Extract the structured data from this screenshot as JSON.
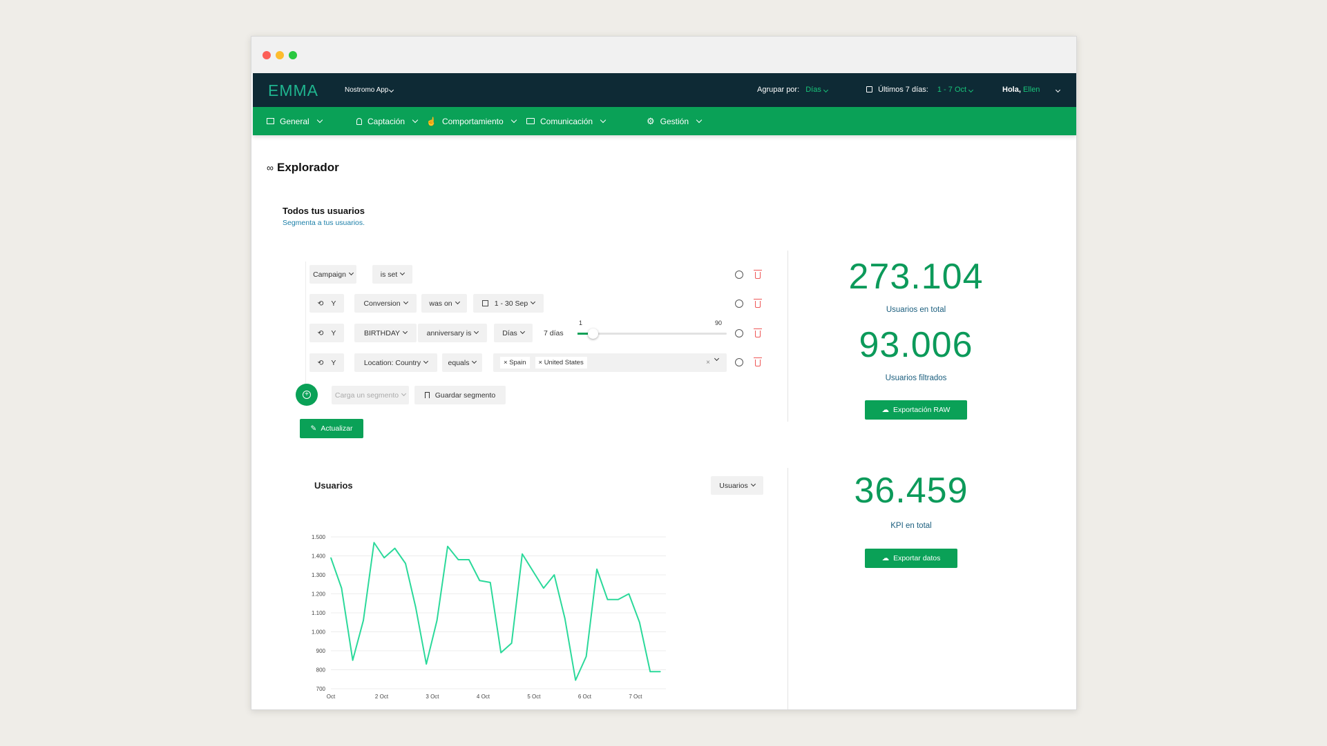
{
  "topbar": {
    "logo": "EMMA",
    "app": "Nostromo App",
    "group_label": "Agrupar por:",
    "group_value": "Días",
    "range_label": "Últimos 7 días:",
    "range_value": "1 - 7 Oct",
    "greeting": "Hola,",
    "user": "Ellen"
  },
  "nav": [
    {
      "label": "General",
      "icon": "dashboard-icon"
    },
    {
      "label": "Captación",
      "icon": "user-icon"
    },
    {
      "label": "Comportamiento",
      "icon": "hand-pointer-icon"
    },
    {
      "label": "Comunicación",
      "icon": "chat-icon"
    },
    {
      "label": "Gestión",
      "icon": "gear-icon"
    }
  ],
  "page": {
    "title": "Explorador",
    "section_title": "Todos tus usuarios",
    "section_subtitle": "Segmenta a tus usuarios."
  },
  "filters": {
    "row1": {
      "field": "Campaign",
      "op": "is set"
    },
    "row2": {
      "join": "Y",
      "field": "Conversion",
      "op": "was on",
      "value": "1 - 30 Sep"
    },
    "row3": {
      "join": "Y",
      "field": "BIRTHDAY",
      "op": "anniversary is",
      "unit": "Días",
      "days": "7 días",
      "slider_min": "1",
      "slider_max": "90",
      "slider_value": 7
    },
    "row4": {
      "join": "Y",
      "field": "Location: Country",
      "op": "equals",
      "tags": [
        "Spain",
        "United States"
      ]
    },
    "load_placeholder": "Carga un segmento",
    "save_label": "Guardar segmento",
    "update_label": "Actualizar"
  },
  "stats": {
    "total_value": "273.104",
    "total_label": "Usuarios en total",
    "filtered_value": "93.006",
    "filtered_label": "Usuarios filtrados",
    "export_raw": "Exportación RAW",
    "kpi_value": "36.459",
    "kpi_label": "KPI en total",
    "export_data": "Exportar datos"
  },
  "chart_panel": {
    "title": "Usuarios",
    "select": "Usuarios"
  },
  "chart_data": {
    "type": "line",
    "title": "Usuarios",
    "xlabel": "",
    "ylabel": "",
    "ylim": [
      700,
      1500
    ],
    "yticks": [
      "1.500",
      "1.400",
      "1.300",
      "1.200",
      "1.100",
      "1.000",
      "900",
      "800",
      "700"
    ],
    "xticks": [
      {
        "label": "Oct",
        "x": 0
      },
      {
        "label": "2 Oct",
        "x": 1
      },
      {
        "label": "3 Oct",
        "x": 2
      },
      {
        "label": "4 Oct",
        "x": 3
      },
      {
        "label": "5 Oct",
        "x": 4
      },
      {
        "label": "6 Oct",
        "x": 5
      },
      {
        "label": "7 Oct",
        "x": 6
      }
    ],
    "line_color": "#2bd99a",
    "x": [
      0,
      0.21,
      0.43,
      0.64,
      0.85,
      1.05,
      1.26,
      1.47,
      1.67,
      1.88,
      2.09,
      2.3,
      2.51,
      2.72,
      2.93,
      3.14,
      3.35,
      3.56,
      3.77,
      3.98,
      4.19,
      4.4,
      4.61,
      4.82,
      5.03,
      5.24,
      5.45,
      5.66,
      5.87,
      6.08,
      6.29,
      6.49
    ],
    "series": [
      {
        "values": [
          1390,
          1230,
          850,
          1060,
          1470,
          1390,
          1440,
          1360,
          1130,
          830,
          1060,
          1450,
          1380,
          1380,
          1270,
          1260,
          890,
          940,
          1410,
          1320,
          1230,
          1300,
          1070,
          745,
          870,
          1330,
          1170,
          1170,
          1200,
          1050,
          790,
          790
        ]
      }
    ]
  }
}
